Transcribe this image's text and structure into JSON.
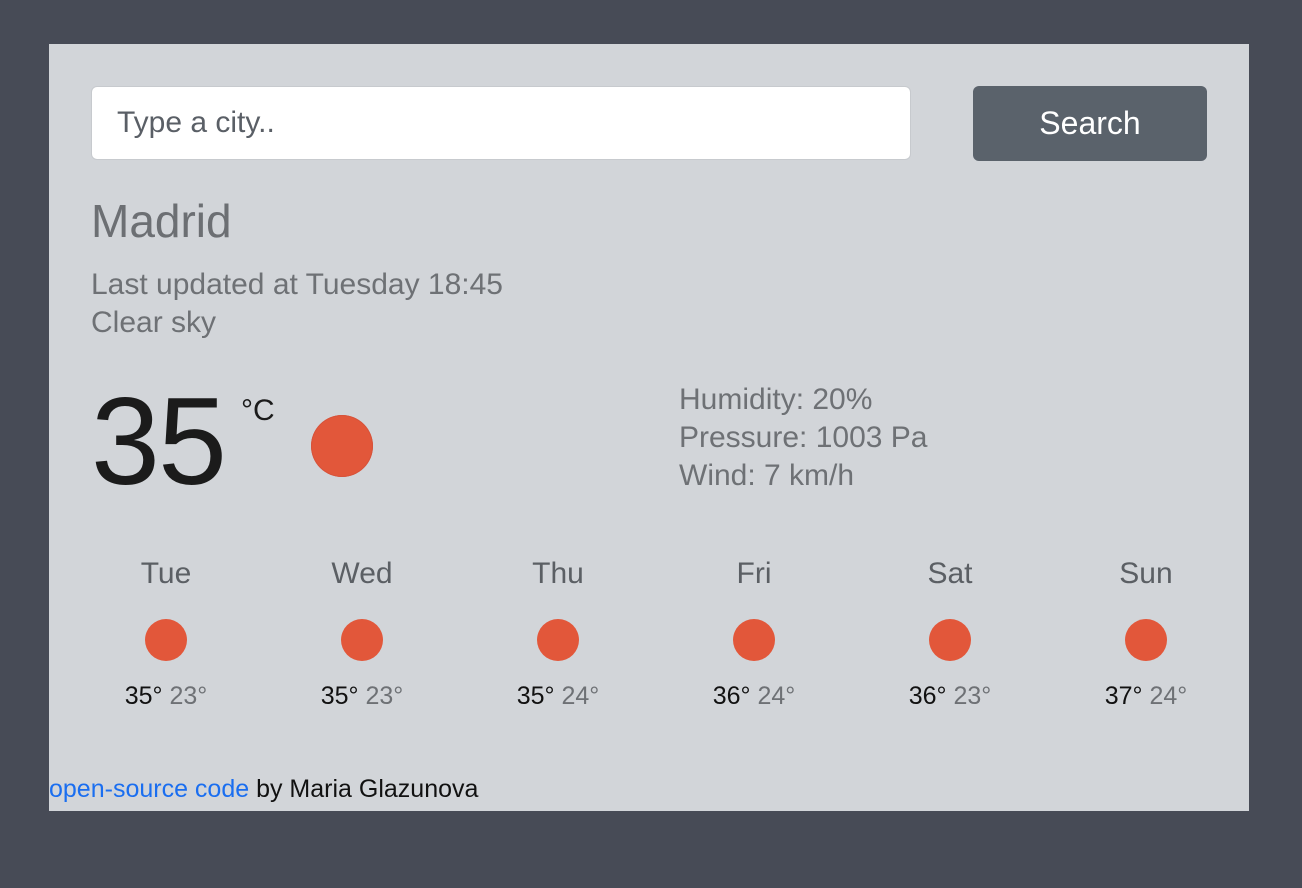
{
  "search": {
    "placeholder": "Type a city..",
    "value": "",
    "button_label": "Search"
  },
  "current": {
    "city": "Madrid",
    "last_updated": "Last updated at Tuesday 18:45",
    "description": "Clear sky",
    "temperature": "35",
    "unit": "°C",
    "icon": "sun-icon",
    "humidity": "Humidity: 20%",
    "pressure": "Pressure: 1003 Pa",
    "wind": "Wind: 7 km/h"
  },
  "forecast": [
    {
      "day": "Tue",
      "icon": "sun-icon",
      "max": "35°",
      "min": "23°"
    },
    {
      "day": "Wed",
      "icon": "sun-icon",
      "max": "35°",
      "min": "23°"
    },
    {
      "day": "Thu",
      "icon": "sun-icon",
      "max": "35°",
      "min": "24°"
    },
    {
      "day": "Fri",
      "icon": "sun-icon",
      "max": "36°",
      "min": "24°"
    },
    {
      "day": "Sat",
      "icon": "sun-icon",
      "max": "36°",
      "min": "23°"
    },
    {
      "day": "Sun",
      "icon": "sun-icon",
      "max": "37°",
      "min": "24°"
    }
  ],
  "footer": {
    "link_text": "open-source code",
    "author_text": " by Maria Glazunova"
  },
  "colors": {
    "page_background": "#474b56",
    "card_background": "#d2d5d9",
    "button_background": "#5a626b",
    "sun": "#e2573a",
    "link": "#1a6ef0"
  }
}
